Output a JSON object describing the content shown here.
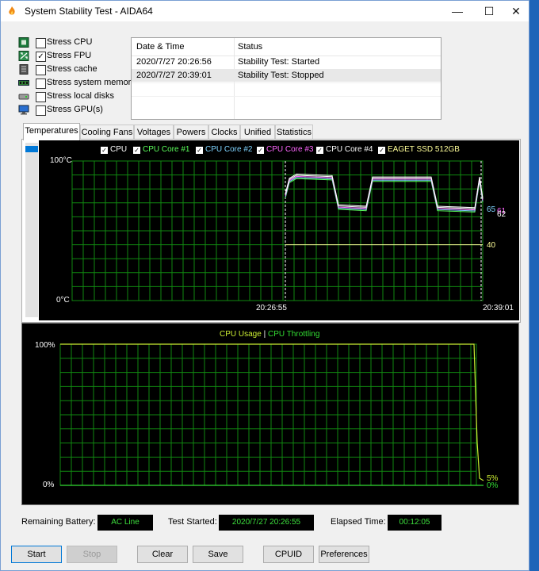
{
  "window": {
    "title": "System Stability Test - AIDA64",
    "minimize_glyph": "—",
    "maximize_glyph": "☐",
    "close_glyph": "✕"
  },
  "stress_options": [
    {
      "label": "Stress CPU",
      "checked": false,
      "icon": "cpu-icon"
    },
    {
      "label": "Stress FPU",
      "checked": true,
      "icon": "fpu-icon"
    },
    {
      "label": "Stress cache",
      "checked": false,
      "icon": "cache-icon"
    },
    {
      "label": "Stress system memory",
      "checked": false,
      "icon": "memory-icon"
    },
    {
      "label": "Stress local disks",
      "checked": false,
      "icon": "disk-icon"
    },
    {
      "label": "Stress GPU(s)",
      "checked": false,
      "icon": "gpu-icon"
    }
  ],
  "log": {
    "headers": [
      "Date & Time",
      "Status"
    ],
    "rows": [
      {
        "datetime": "2020/7/27 20:26:56",
        "status": "Stability Test: Started"
      },
      {
        "datetime": "2020/7/27 20:39:01",
        "status": "Stability Test: Stopped"
      }
    ]
  },
  "tabs": [
    {
      "label": "Temperatures",
      "active": true
    },
    {
      "label": "Cooling Fans",
      "active": false
    },
    {
      "label": "Voltages",
      "active": false
    },
    {
      "label": "Powers",
      "active": false
    },
    {
      "label": "Clocks",
      "active": false
    },
    {
      "label": "Unified",
      "active": false
    },
    {
      "label": "Statistics",
      "active": false
    }
  ],
  "temperature_graph": {
    "legend": [
      {
        "label": "CPU",
        "color": "#ffffff",
        "checked": true
      },
      {
        "label": "CPU Core #1",
        "color": "#5bff5b",
        "checked": true
      },
      {
        "label": "CPU Core #2",
        "color": "#7fd4ff",
        "checked": true
      },
      {
        "label": "CPU Core #3",
        "color": "#ff66ff",
        "checked": true
      },
      {
        "label": "CPU Core #4",
        "color": "#ffffff",
        "checked": true
      },
      {
        "label": "EAGET SSD 512GB",
        "color": "#ffff99",
        "checked": true
      }
    ],
    "y_top_label": "100°C",
    "y_bottom_label": "0°C",
    "x_start_label": "20:26:55",
    "x_end_label": "20:39:01",
    "value_labels": {
      "a": "65",
      "b": "61",
      "c": "62",
      "ssd": "40"
    },
    "grid_color": "#118811"
  },
  "usage_graph": {
    "legend_usage": "CPU Usage",
    "legend_sep": "|",
    "legend_throttling": "CPU Throttling",
    "usage_color": "#ccee33",
    "throttling_color": "#33dd33",
    "y_top_label": "100%",
    "y_bottom_label": "0%",
    "usage_value": "5%",
    "throttling_value": "0%",
    "grid_color": "#118811"
  },
  "status": {
    "battery_label": "Remaining Battery:",
    "battery_value": "AC Line",
    "started_label": "Test Started:",
    "started_value": "2020/7/27 20:26:55",
    "elapsed_label": "Elapsed Time:",
    "elapsed_value": "00:12:05"
  },
  "buttons": {
    "start": "Start",
    "stop": "Stop",
    "clear": "Clear",
    "save": "Save",
    "cpuid": "CPUID",
    "preferences": "Preferences"
  }
}
